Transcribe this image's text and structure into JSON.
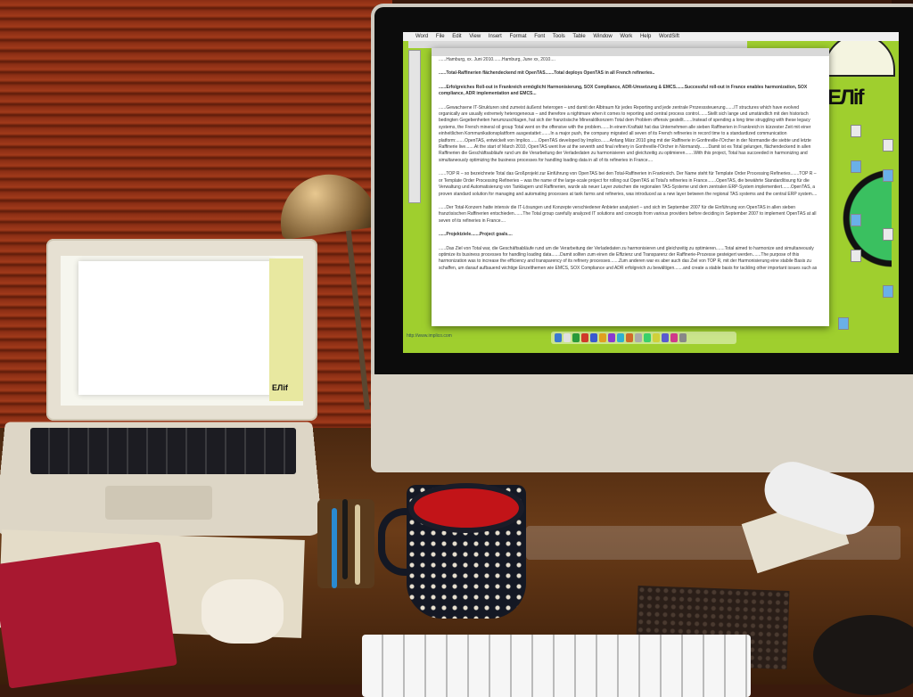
{
  "screen": {
    "menubar_items": [
      "Word",
      "File",
      "Edit",
      "View",
      "Insert",
      "Format",
      "Font",
      "Tools",
      "Table",
      "Window",
      "Work",
      "Help",
      "WordSift"
    ],
    "document": {
      "dateline": "......Hamburg, xx. Juni 2010.......Hamburg, June xx, 2010....",
      "headline": "......Total-Raffinerien flächendeckend mit OpenTAS.......Total deploys OpenTAS in all French refineries..",
      "subhead": "......Erfolgreiches Roll-out in Frankreich ermöglicht Harmonisierung, SOX Compliance, ADR-Umsetzung & EMCS.......Successful roll-out in France enables harmonization, SOX compliance, ADR implementation and EMCS...",
      "para1": "......Gewachsene IT-Strukturen sind zumeist äußerst heterogen – und damit der Albtraum für jedes Reporting und jede zentrale Prozesssteuerung.......IT structures which have evolved organically are usually extremely heterogeneous – and therefore a nightmare when it comes to reporting and central process control.......Stellt sich lange und umständlich mit den historisch bedingten Gegebenheiten herumzuschlagen, hat sich der französische Mineralölkonzern Total dem Problem offensiv gestellt.......Instead of spending a long time struggling with these legacy systems, the French mineral oil group Total went on the offensive with the problem.......In einem Kraftakt hat das Unternehmen alle sieben Raffinerien in Frankreich in kürzester Zeit mit einer einheitlichen Kommunikationsplattform ausgestattet:.......In a major push, the company migrated all seven of its French refineries in record time to a standardized communication platform:.......OpenTAS, entwickelt von Implico.......OpenTAS developed by Implico.......Anfang März 2010 ging mit der Raffinerie in Gonfreville-l'Orcher in der Normandie die siebte und letzte Raffinerie live.......At the start of March 2010, OpenTAS went live at the seventh and final refinery in Gonfreville-l'Orcher in Normandy.......Damit ist es Total gelungen, flächendeckend in allen Raffinerien die Geschäftsabläufe rund um die Verarbeitung der Verladedaten zu harmonisieren und gleichzeitig zu optimieren.......With this project, Total has succeeded in harmonizing and simultaneously optimizing the business processes for handling loading data in all of its refineries in France....",
      "para2": "......TOP R – so bezeichnete Total das Großprojekt zur Einführung von OpenTAS bei den Total-Raffinerien in Frankreich. Der Name steht für Template Order Processing Refineries.......TOP R – or Template Order Processing Refineries – was the name of the large-scale project for rolling out OpenTAS at Total's refineries in France.......OpenTAS, die bewährte Standardlösung für die Verwaltung und Automatisierung von Tanklagern und Raffinerien, wurde als neuer Layer zwischen die regionalen TAS-Systeme und dem zentralen ERP-System implementiert.......OpenTAS, a proven standard solution for managing and automating processes at tank farms and refineries, was introduced as a new layer between the regional TAS systems and the central ERP system....",
      "para3": "......Der Total-Konzern hatte intensiv die IT-Lösungen und Konzepte verschiedener Anbieter analysiert – und sich im September 2007 für die Einführung von OpenTAS in allen sieben französischen Raffinerien entschieden.......The Total group carefully analyzed IT solutions and concepts from various providers before deciding in September 2007 to implement OpenTAS at all seven of its refineries in France....",
      "section": "......Projektziele.......Project goals....",
      "para4": "......Das Ziel von Total war, die Geschäftsabläufe rund um die Verarbeitung der Verladedaten zu harmonisieren und gleichzeitig zu optimieren.......Total aimed to harmonize and simultaneously optimize its business processes for handling loading data.......Damit sollten zum einen die Effizienz und Transparenz der Raffinerie-Prozesse gesteigert werden.......The purpose of this harmonization was to increase the efficiency and transparency of its refinery processes.......Zum anderen war es aber auch das Ziel von TOP R, mit der Harmonisierung eine stabile Basis zu schaffen, um darauf aufbauend wichtige Einzelthemen wie EMCS, SOX Compliance und ADR erfolgreich zu bewältigen.......and create a stable basis for tackling other important issues such as"
    },
    "status_url": "http://www.implico.com"
  },
  "wallpaper": {
    "text": "ЕЛif"
  },
  "laptop": {
    "wallpaper_text": "ЕЛif"
  }
}
